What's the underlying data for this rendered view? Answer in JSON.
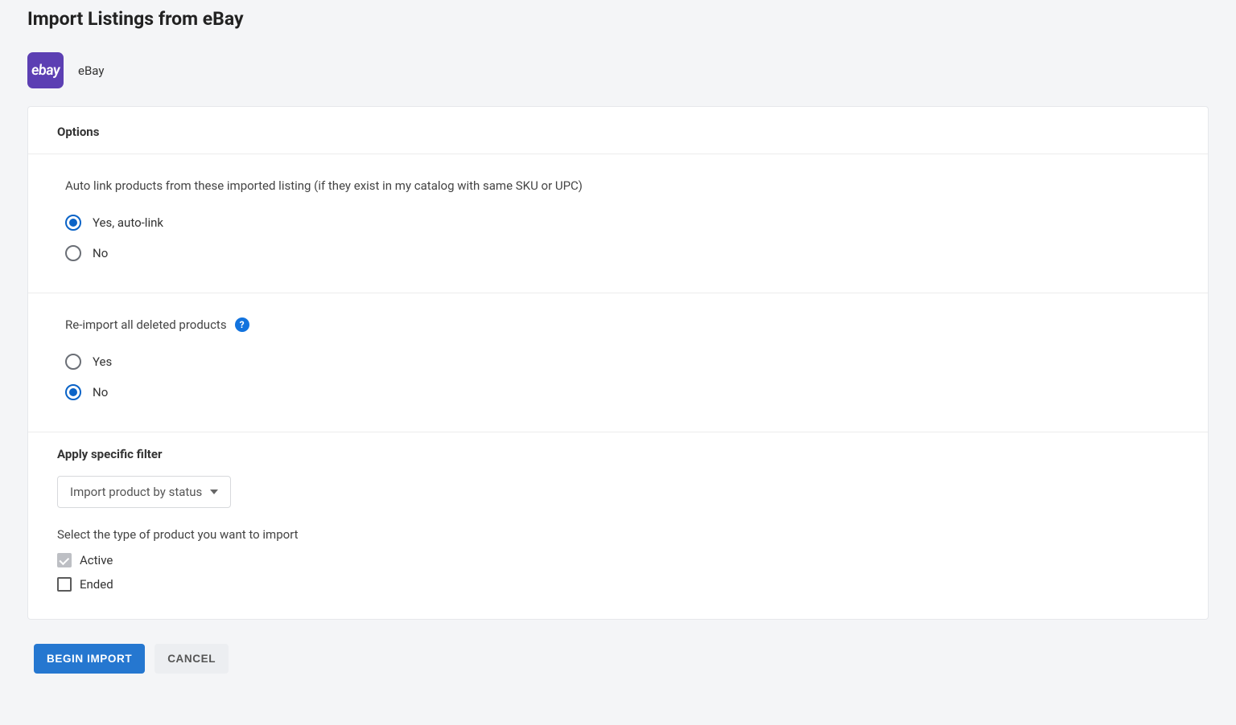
{
  "pageTitle": "Import Listings from eBay",
  "source": {
    "badge": "ebay",
    "name": "eBay"
  },
  "options": {
    "header": "Options",
    "autoLink": {
      "prompt": "Auto link products from these imported listing (if they exist in my catalog with same SKU or UPC)",
      "yesLabel": "Yes, auto-link",
      "noLabel": "No",
      "selected": "yes"
    },
    "reimport": {
      "prompt": "Re-import all deleted products",
      "helpGlyph": "?",
      "yesLabel": "Yes",
      "noLabel": "No",
      "selected": "no"
    },
    "filter": {
      "heading": "Apply specific filter",
      "dropdown": "Import product by status",
      "sub": "Select the type of product you want to import",
      "activeLabel": "Active",
      "endedLabel": "Ended",
      "activeChecked": true,
      "endedChecked": false
    }
  },
  "buttons": {
    "primary": "BEGIN IMPORT",
    "secondary": "CANCEL"
  }
}
